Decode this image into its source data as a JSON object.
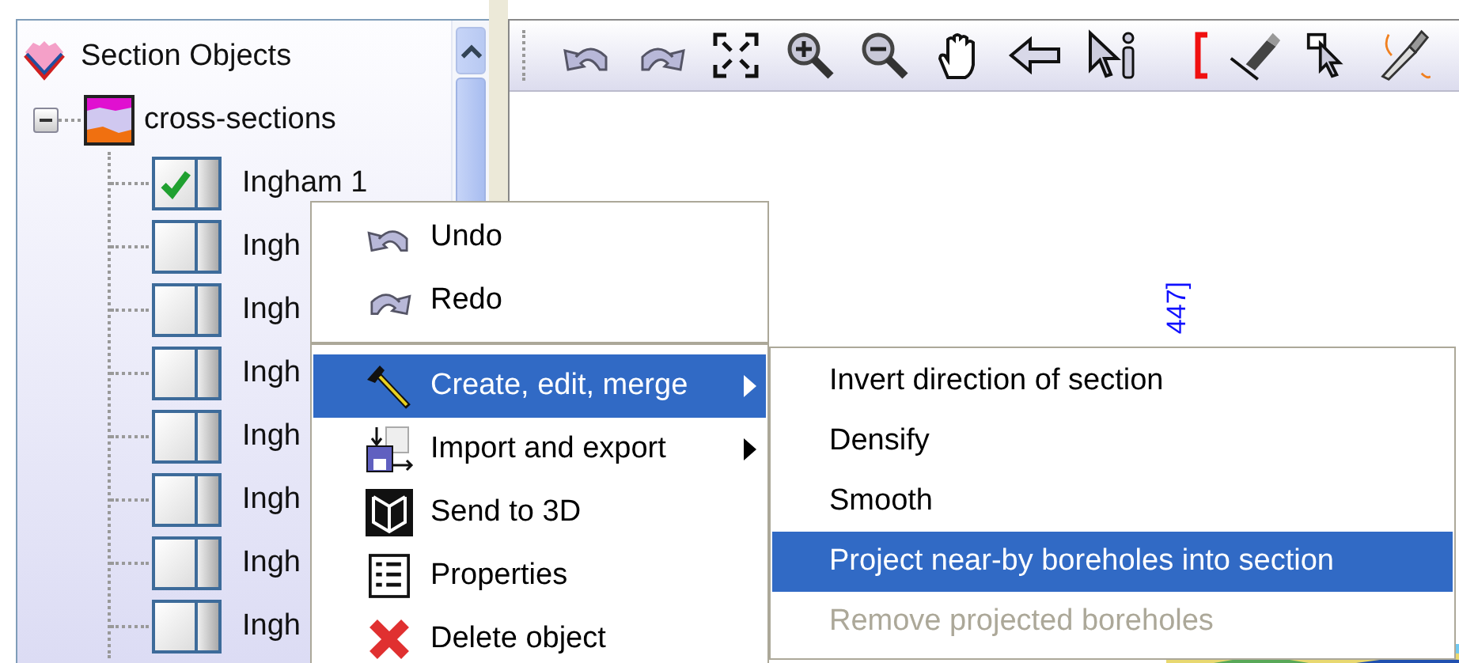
{
  "tree": {
    "label": "Section Objects",
    "children": [
      {
        "label": "cross-sections",
        "expanded": true,
        "children": [
          {
            "label": "Ingham 1",
            "checked": true
          },
          {
            "label": "Ingh",
            "checked": false
          },
          {
            "label": "Ingh",
            "checked": false
          },
          {
            "label": "Ingh",
            "checked": false
          },
          {
            "label": "Ingh",
            "checked": false
          },
          {
            "label": "Ingh",
            "checked": false
          },
          {
            "label": "Ingh",
            "checked": false
          },
          {
            "label": "Ingh",
            "checked": false
          }
        ]
      }
    ]
  },
  "canvas": {
    "label": "447]"
  },
  "context_menu": {
    "items": [
      {
        "kind": "item",
        "label": "Undo",
        "selected": false,
        "submenu": false
      },
      {
        "kind": "item",
        "label": "Redo",
        "selected": false,
        "submenu": false
      },
      {
        "kind": "separator"
      },
      {
        "kind": "item",
        "label": "Create, edit, merge",
        "selected": true,
        "submenu": true
      },
      {
        "kind": "item",
        "label": "Import and export",
        "selected": false,
        "submenu": true
      },
      {
        "kind": "item",
        "label": "Send to 3D",
        "selected": false,
        "submenu": false
      },
      {
        "kind": "item",
        "label": "Properties",
        "selected": false,
        "submenu": false
      },
      {
        "kind": "item",
        "label": "Delete object",
        "selected": false,
        "submenu": false
      }
    ]
  },
  "submenu": {
    "items": [
      {
        "label": "Invert direction of section",
        "selected": false,
        "disabled": false
      },
      {
        "label": "Densify",
        "selected": false,
        "disabled": false
      },
      {
        "label": "Smooth",
        "selected": false,
        "disabled": false
      },
      {
        "label": "Project near-by boreholes into section",
        "selected": true,
        "disabled": false
      },
      {
        "label": "Remove projected boreholes",
        "selected": false,
        "disabled": true
      }
    ]
  }
}
